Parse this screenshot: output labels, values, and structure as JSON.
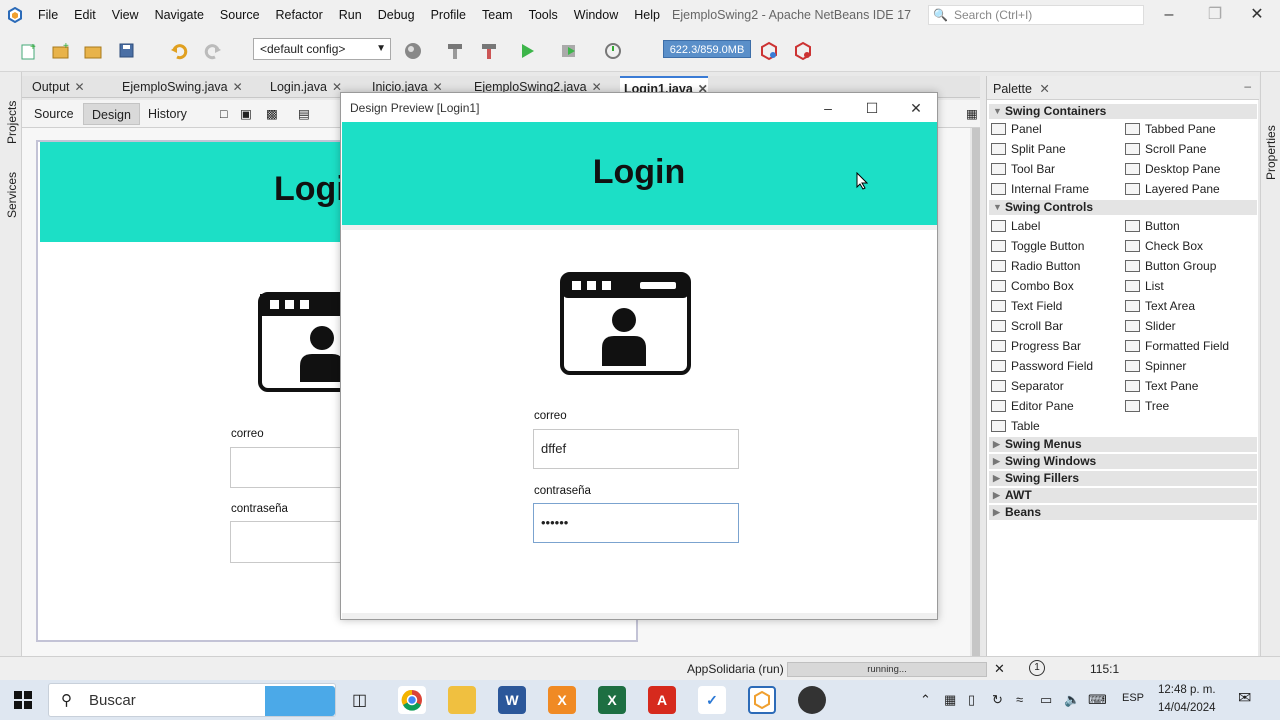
{
  "menubar": {
    "items": [
      "File",
      "Edit",
      "View",
      "Navigate",
      "Source",
      "Refactor",
      "Run",
      "Debug",
      "Profile",
      "Team",
      "Tools",
      "Window",
      "Help"
    ],
    "window_title": "EjemploSwing2 - Apache NetBeans IDE 17",
    "search_placeholder": "Search (Ctrl+I)"
  },
  "toolbar": {
    "config": "<default config>",
    "memory": "622.3/859.0MB"
  },
  "sidebar_left": {
    "projects": "Projects",
    "services": "Services"
  },
  "sidebar_right": {
    "properties": "Properties"
  },
  "editor_tabs": [
    {
      "label": "Output"
    },
    {
      "label": "EjemploSwing.java"
    },
    {
      "label": "Login.java"
    },
    {
      "label": "Inicio.java"
    },
    {
      "label": "EjemploSwing2.java"
    },
    {
      "label": "Login1.java"
    }
  ],
  "editor_modes": {
    "source": "Source",
    "design": "Design",
    "history": "History"
  },
  "form": {
    "title": "Login",
    "email_label": "correo",
    "password_label": "contraseña"
  },
  "preview": {
    "window_title": "Design Preview [Login1]",
    "title": "Login",
    "email_label": "correo",
    "email_value": "dffef",
    "password_label": "contraseña",
    "password_value": "••••••"
  },
  "palette": {
    "title": "Palette",
    "categories": {
      "containers": "Swing Containers",
      "controls": "Swing Controls",
      "menus": "Swing Menus",
      "windows": "Swing Windows",
      "fillers": "Swing Fillers",
      "awt": "AWT",
      "beans": "Beans"
    },
    "containers": [
      "Panel",
      "Tabbed Pane",
      "Split Pane",
      "Scroll Pane",
      "Tool Bar",
      "Desktop Pane",
      "Internal Frame",
      "Layered Pane"
    ],
    "controls": [
      "Label",
      "Button",
      "Toggle Button",
      "Check Box",
      "Radio Button",
      "Button Group",
      "Combo Box",
      "List",
      "Text Field",
      "Text Area",
      "Scroll Bar",
      "Slider",
      "Progress Bar",
      "Formatted Field",
      "Password Field",
      "Spinner",
      "Separator",
      "Text Pane",
      "Editor Pane",
      "Tree",
      "Table"
    ]
  },
  "statusbar": {
    "project": "AppSolidaria (run)",
    "progress": "running...",
    "notifications": "1",
    "caret": "115:1"
  },
  "taskbar": {
    "search": "Buscar",
    "lang": "ESP",
    "time": "12:48 p. m.",
    "date": "14/04/2024"
  },
  "colors": {
    "header": "#1cdfc6",
    "accent": "#3a7bd5"
  }
}
